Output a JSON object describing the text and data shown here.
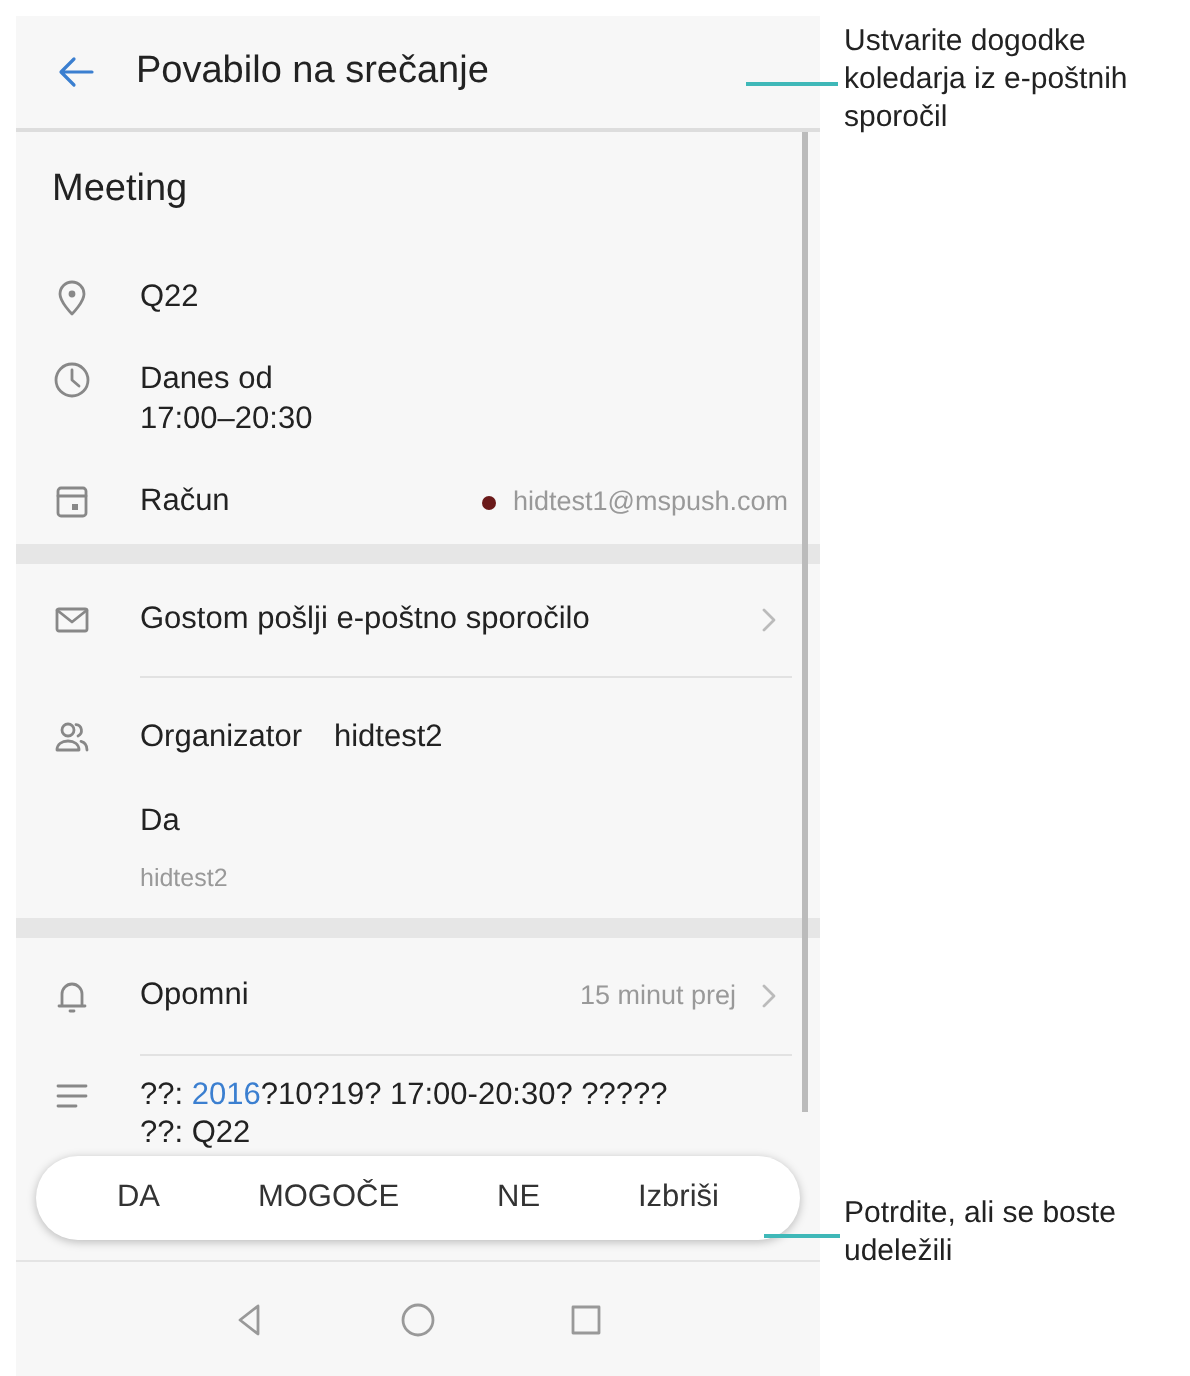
{
  "header": {
    "title": "Povabilo na srečanje"
  },
  "event": {
    "title": "Meeting",
    "location": "Q22",
    "time_lines": [
      "Danes od",
      "17:00–20:30"
    ],
    "account": {
      "label": "Račun",
      "email": "hidtest1@mspush.com",
      "color": "#6b1a1a"
    }
  },
  "email_guests": {
    "label": "Gostom pošlji e-poštno sporočilo"
  },
  "organizer": {
    "label": "Organizator",
    "name": "hidtest2",
    "response": "Da",
    "attendee": "hidtest2"
  },
  "reminder": {
    "label": "Opomni",
    "value": "15 minut prej"
  },
  "note": {
    "lines": [
      {
        "prefix": "??: ",
        "link": "2016",
        "suffix": "?10?19? 17:00-20:30? ?????"
      },
      {
        "prefix": "??: Q22"
      }
    ]
  },
  "responses": [
    "DA",
    "MOGOČE",
    "NE",
    "Izbriši"
  ],
  "callouts": [
    {
      "text": "Ustvarite dogodke koledarja iz e-poštnih sporočil"
    },
    {
      "text": "Potrdite, ali se boste udeležili"
    }
  ]
}
